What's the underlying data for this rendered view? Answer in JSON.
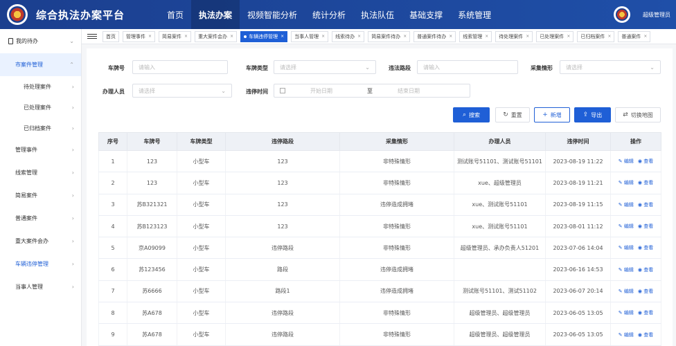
{
  "app": {
    "title": "综合执法办案平台"
  },
  "topnav": [
    {
      "label": "首页",
      "active": false
    },
    {
      "label": "执法办案",
      "active": true
    },
    {
      "label": "视频智能分析",
      "active": false
    },
    {
      "label": "统计分析",
      "active": false
    },
    {
      "label": "执法队伍",
      "active": false
    },
    {
      "label": "基础支撑",
      "active": false
    },
    {
      "label": "系统管理",
      "active": false
    }
  ],
  "user": {
    "name": "超级管理员"
  },
  "sidebar": {
    "top": "我的待办",
    "group": "市案件管理",
    "subs": [
      "待处理案件",
      "已处理案件",
      "已归档案件"
    ],
    "items": [
      "管理事件",
      "线索管理",
      "简易案件",
      "普通案件",
      "重大案件会办",
      "车辆违停管理",
      "当事人管理"
    ]
  },
  "tabs": [
    "首页",
    "管理事件",
    "简易案件",
    "重大案件会办",
    "车辆违停管理",
    "当事人管理",
    "线索待办",
    "简易案件待办",
    "普通案件待办",
    "线索管理",
    "待处理案件",
    "已处理案件",
    "已归档案件",
    "普通案件"
  ],
  "filters": {
    "plate_label": "车牌号",
    "plate_ph": "请输入",
    "plate_type_label": "车牌类型",
    "plate_type_ph": "请选择",
    "road_label": "违法路段",
    "road_ph": "请输入",
    "capture_label": "采集情形",
    "capture_ph": "请选择",
    "handler_label": "办理人员",
    "handler_ph": "请选择",
    "time_label": "违停时间",
    "start_ph": "开始日期",
    "to": "至",
    "end_ph": "结束日期"
  },
  "buttons": {
    "search": "搜索",
    "reset": "重置",
    "add": "新增",
    "export": "导出",
    "map": "切换地图"
  },
  "table": {
    "headers": [
      "序号",
      "车牌号",
      "车牌类型",
      "违停路段",
      "采集情形",
      "办理人员",
      "违停时间",
      "操作"
    ],
    "edit": "编辑",
    "view": "查看",
    "rows": [
      [
        "1",
        "123",
        "小型车",
        "123",
        "非特殊情形",
        "测试账号51101、测试账号51101",
        "2023-08-19 11:22"
      ],
      [
        "2",
        "123",
        "小型车",
        "123",
        "非特殊情形",
        "xue、超级管理员",
        "2023-08-19 11:21"
      ],
      [
        "3",
        "苏B321321",
        "小型车",
        "123",
        "违停造成拥堵",
        "xue、测试账号51101",
        "2023-08-19 11:15"
      ],
      [
        "4",
        "苏B123123",
        "小型车",
        "123",
        "非特殊情形",
        "xue、测试账号51101",
        "2023-08-01 11:12"
      ],
      [
        "5",
        "京A09099",
        "小型车",
        "违停路段",
        "非特殊情形",
        "超级管理员、承办负责人51201",
        "2023-07-06 14:04"
      ],
      [
        "6",
        "苏123456",
        "小型车",
        "路段",
        "违停造成拥堵",
        "",
        "2023-06-16 14:53"
      ],
      [
        "7",
        "苏6666",
        "小型车",
        "路段1",
        "违停造成拥堵",
        "测试账号51101、测试51102",
        "2023-06-07 20:14"
      ],
      [
        "8",
        "苏A678",
        "小型车",
        "违停路段",
        "非特殊情形",
        "超级管理员、超级管理员",
        "2023-06-05 13:05"
      ],
      [
        "9",
        "苏A678",
        "小型车",
        "违停路段",
        "非特殊情形",
        "超级管理员、超级管理员",
        "2023-06-05 13:05"
      ]
    ]
  }
}
